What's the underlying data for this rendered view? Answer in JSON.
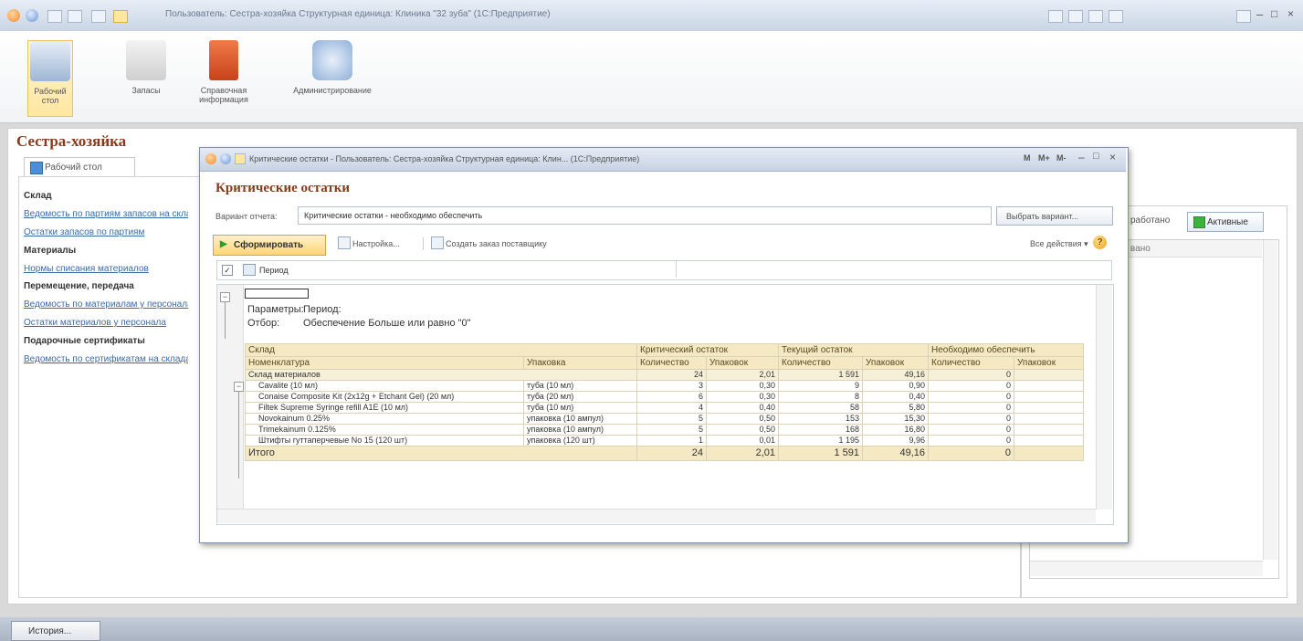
{
  "window": {
    "title": "Пользователь: Сестра-хозяйка  Структурная единица: Клиника \"32 зуба\" (1С:Предприятие)"
  },
  "sections": [
    {
      "label1": "Рабочий",
      "label2": "стол"
    },
    {
      "label1": "Запасы",
      "label2": ""
    },
    {
      "label1": "Справочная",
      "label2": "информация"
    },
    {
      "label1": "Администрирование",
      "label2": ""
    }
  ],
  "desktop": {
    "title": "Сестра-хозяйка",
    "tab_label": "Рабочий стол",
    "nav": [
      {
        "type": "h",
        "text": "Склад"
      },
      {
        "type": "l",
        "text": "Ведомость по партиям запасов на складах"
      },
      {
        "type": "l",
        "text": "Остатки запасов по партиям"
      },
      {
        "type": "h",
        "text": "Материалы"
      },
      {
        "type": "l",
        "text": "Нормы списания материалов"
      },
      {
        "type": "h",
        "text": "Перемещение, передача"
      },
      {
        "type": "l",
        "text": "Ведомость по материалам у персонала"
      },
      {
        "type": "l",
        "text": "Остатки материалов у персонала"
      },
      {
        "type": "h",
        "text": "Подарочные сертификаты"
      },
      {
        "type": "l",
        "text": "Ведомость по сертификатам на складах"
      }
    ],
    "right_partial_label": "работано",
    "active_button": "Активные",
    "right_list_header": "вано"
  },
  "history_button": "История...",
  "report": {
    "window_title": "Критические остатки - Пользователь: Сестра-хозяйка  Структурная единица: Клин...  (1С:Предприятие)",
    "heading": "Критические остатки",
    "variant_label": "Вариант отчета:",
    "variant_value": "Критические остатки - необходимо обеспечить",
    "choose_variant": "Выбрать вариант...",
    "generate": "Сформировать",
    "settings": "Настройка...",
    "create_order": "Создать заказ поставщику",
    "all_actions": "Все действия ▾",
    "help": "?",
    "period_label": "Период",
    "params_label": "Параметры:",
    "params_value": "Период:",
    "filter_label": "Отбор:",
    "filter_value": "Обеспечение Больше или равно \"0\"",
    "columns": {
      "warehouse": "Склад",
      "nomenclature": "Номенклатура",
      "packaging": "Упаковка",
      "critical": "Критический остаток",
      "current": "Текущий остаток",
      "needed": "Необходимо обеспечить",
      "qty": "Количество",
      "packs": "Упаковок"
    },
    "group": {
      "name": "Склад материалов",
      "crit_qty": "24",
      "crit_packs": "2,01",
      "cur_qty": "1 591",
      "cur_packs": "49,16",
      "need_qty": "0",
      "need_packs": ""
    },
    "rows": [
      {
        "name": "Cavalite (10 мл)",
        "pack": "туба (10 мл)",
        "crit_qty": "3",
        "crit_packs": "0,30",
        "cur_qty": "9",
        "cur_packs": "0,90",
        "need_qty": "0",
        "need_packs": ""
      },
      {
        "name": "Conaise Composite Kit (2x12g + Etchant Gel) (20 мл)",
        "pack": "туба (20 мл)",
        "crit_qty": "6",
        "crit_packs": "0,30",
        "cur_qty": "8",
        "cur_packs": "0,40",
        "need_qty": "0",
        "need_packs": ""
      },
      {
        "name": "Filtek Supreme Syringe refill A1E (10 мл)",
        "pack": "туба (10 мл)",
        "crit_qty": "4",
        "crit_packs": "0,40",
        "cur_qty": "58",
        "cur_packs": "5,80",
        "need_qty": "0",
        "need_packs": ""
      },
      {
        "name": "Novokainum 0.25%",
        "pack": "упаковка (10 ампул)",
        "crit_qty": "5",
        "crit_packs": "0,50",
        "cur_qty": "153",
        "cur_packs": "15,30",
        "need_qty": "0",
        "need_packs": ""
      },
      {
        "name": "Trimekainum 0.125%",
        "pack": "упаковка (10 ампул)",
        "crit_qty": "5",
        "crit_packs": "0,50",
        "cur_qty": "168",
        "cur_packs": "16,80",
        "need_qty": "0",
        "need_packs": ""
      },
      {
        "name": "Штифты гуттаперчевые No 15  (120 шт)",
        "pack": "упаковка (120 шт)",
        "crit_qty": "1",
        "crit_packs": "0,01",
        "cur_qty": "1 195",
        "cur_packs": "9,96",
        "need_qty": "0",
        "need_packs": ""
      }
    ],
    "total": {
      "label": "Итого",
      "crit_qty": "24",
      "crit_packs": "2,01",
      "cur_qty": "1 591",
      "cur_packs": "49,16",
      "need_qty": "0",
      "need_packs": ""
    }
  }
}
